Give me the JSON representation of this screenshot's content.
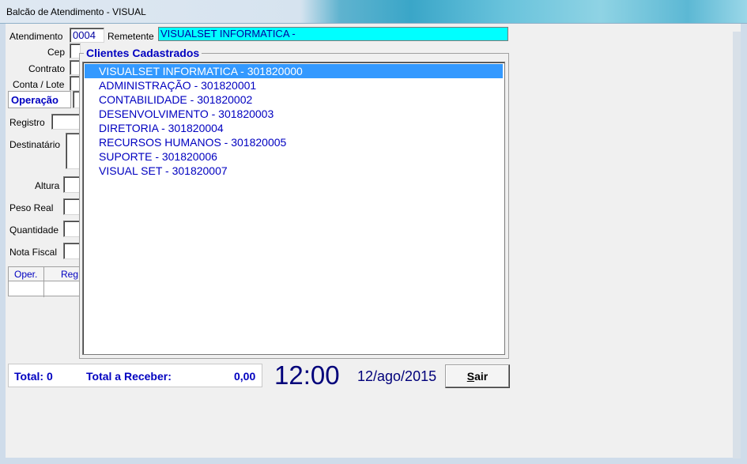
{
  "window": {
    "title": "Balcão de Atendimento - VISUAL"
  },
  "form": {
    "atendimento_label": "Atendimento",
    "atendimento_value": "0004",
    "remetente_label": "Remetente",
    "remetente_value": "VISUALSET INFORMATICA -",
    "cep_label": "Cep",
    "contrato_label": "Contrato",
    "conta_lote_label": "Conta / Lote",
    "operacao_label": "Operação",
    "registro_label": "Registro",
    "destinatario_label": "Destinatário",
    "altura_label": "Altura",
    "peso_real_label": "Peso Real",
    "quantidade_label": "Quantidade",
    "nota_fiscal_label": "Nota Fiscal"
  },
  "grid": {
    "columns": [
      "Oper.",
      "Reg"
    ]
  },
  "clientes": {
    "title": "Clientes Cadastrados",
    "selected_index": 0,
    "items": [
      "VISUALSET INFORMATICA - 301820000",
      "ADMINISTRAÇÃO - 301820001",
      "CONTABILIDADE - 301820002",
      "DESENVOLVIMENTO - 301820003",
      "DIRETORIA - 301820004",
      "RECURSOS HUMANOS - 301820005",
      "SUPORTE - 301820006",
      "VISUAL SET - 301820007"
    ]
  },
  "status": {
    "total_label": "Total: 0",
    "receber_label": "Total a Receber:",
    "receber_value": "0,00",
    "time": "12:00",
    "date": "12/ago/2015",
    "sair_accel": "S",
    "sair_rest": "air"
  },
  "colors": {
    "accent": "#0000c0",
    "selection": "#3399ff",
    "remetente_bg": "#00ffff"
  }
}
